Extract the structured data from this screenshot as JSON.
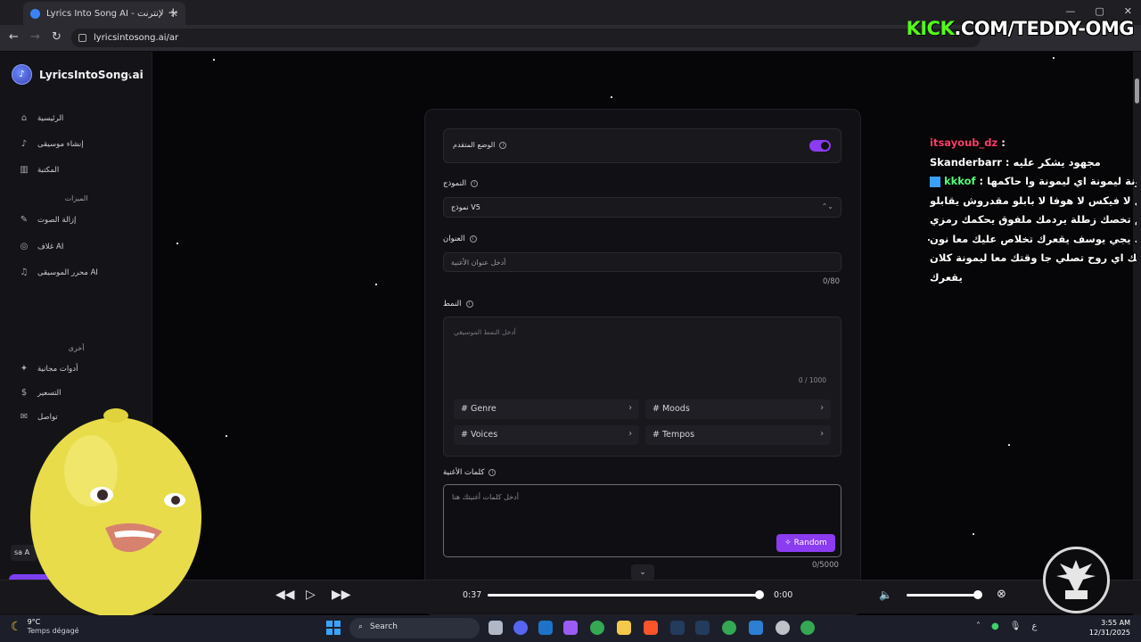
{
  "browser": {
    "tab_title": "Lyrics Into Song AI - مولد الأغاني عبر الإنترنت",
    "url": "lyricsintosong.ai/ar",
    "close_glyph": "✕",
    "new_tab_glyph": "+"
  },
  "overlay": {
    "kick_brand": "KICK",
    "kick_rest": ".COM/TEDDY-OMG"
  },
  "sidebar": {
    "brand": "LyricsIntoSong.ai",
    "items": [
      {
        "label": "الرئيسية",
        "icon": "home-icon",
        "glyph": "⌂"
      },
      {
        "label": "إنشاء موسيقى",
        "icon": "music-icon",
        "glyph": "♪"
      },
      {
        "label": "المكتبة",
        "icon": "library-icon",
        "glyph": "▥"
      }
    ],
    "features_heading": "الميزات",
    "features": [
      {
        "label": "إزالة الصوت",
        "icon": "mic-icon",
        "glyph": "✎"
      },
      {
        "label": "غلاف AI",
        "icon": "cover-icon",
        "glyph": "◎"
      },
      {
        "label": "محرر الموسيقى AI",
        "icon": "editor-icon",
        "glyph": "♫"
      }
    ],
    "other_heading": "أخرى",
    "other": [
      {
        "label": "أدوات مجانية",
        "icon": "tools-icon",
        "glyph": "✦"
      },
      {
        "label": "التسعير",
        "icon": "dollar-icon",
        "glyph": "$"
      },
      {
        "label": "تواصل",
        "icon": "mail-icon",
        "glyph": "✉"
      }
    ],
    "user_snippet": "sa A"
  },
  "form": {
    "advanced_mode_label": "الوضع المتقدم",
    "advanced_mode_on": true,
    "model_label": "النموذج",
    "model_value": "نموذج V5",
    "title_label": "العنوان",
    "title_placeholder": "أدخل عنوان الأغنية",
    "title_counter": "0/80",
    "style_label": "النمط",
    "style_placeholder": "أدخل النمط الموسيقي",
    "style_counter": "0 / 1000",
    "chips": [
      {
        "label": "# Genre"
      },
      {
        "label": "# Moods"
      },
      {
        "label": "# Voices"
      },
      {
        "label": "# Tempos"
      }
    ],
    "lyrics_label": "كلمات الأغنية",
    "lyrics_placeholder": "أدخل كلمات أغنيتك هنا",
    "random_button": "Random",
    "lyrics_counter": "0/5000"
  },
  "player": {
    "current_time": "0:37",
    "end_time": "0:00",
    "progress_fraction": 1.0,
    "volume_fraction": 1.0
  },
  "chat": [
    {
      "user": "itsayoub_dz",
      "sep": " : ",
      "msg": ""
    },
    {
      "user": "Skanderbarr",
      "sep": " : ",
      "msg": "مجهود يشكر عليه"
    },
    {
      "user": "kkkof",
      "sep": " : ",
      "msg": "ليمونة ليمونة اي ليمونة وا حاكمها"
    },
    {
      "user": "",
      "sep": "",
      "msg": "ماتقول لا فيكس لا هوفا لا بابلو مقدروش يقابلو"
    },
    {
      "user": "",
      "sep": "",
      "msg": "كوف حاكم تخصك زطلة يردمك ملفوق يحكمك رمزي"
    },
    {
      "user": "",
      "sep": "",
      "msg": "يسلكك يجي يوسف يقعرك تخلاص عليك معا نون"
    },
    {
      "user": "",
      "sep": "",
      "msg": "يدفنك اي روح تصلي جا وقتك معا ليمونة كلان"
    },
    {
      "user": "",
      "sep": "",
      "msg": "يقعرك"
    }
  ],
  "taskbar": {
    "temp": "9°C",
    "weather_desc": "Temps dégagé",
    "search": "Search",
    "time": "3:55 AM",
    "date": "12/31/2025",
    "lang": "ع"
  },
  "colors": {
    "accent": "#8b3cf0",
    "kick_green": "#53fc18"
  }
}
